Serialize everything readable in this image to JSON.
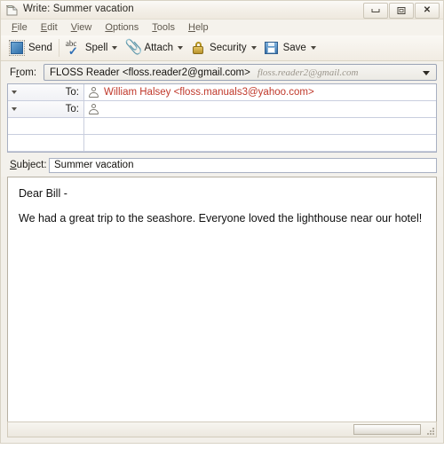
{
  "window": {
    "title": "Write: Summer vacation",
    "title_icon": "compose-document-icon",
    "controls": {
      "minimize": "minimize-button",
      "maximize": "maximize-button",
      "close": "close-button",
      "close_glyph": "✕"
    }
  },
  "menubar": {
    "items": [
      {
        "label": "File",
        "accel": "F"
      },
      {
        "label": "Edit",
        "accel": "E"
      },
      {
        "label": "View",
        "accel": "V"
      },
      {
        "label": "Options",
        "accel": "O"
      },
      {
        "label": "Tools",
        "accel": "T"
      },
      {
        "label": "Help",
        "accel": "H"
      }
    ]
  },
  "toolbar": {
    "send_label": "Send",
    "spell_label": "Spell",
    "spell_abc": "abc",
    "spell_check_glyph": "✓",
    "attach_label": "Attach",
    "attach_glyph": "📎",
    "security_label": "Security",
    "save_label": "Save"
  },
  "headers": {
    "from_label": "From:",
    "from_accel": "r",
    "from_value": "FLOSS Reader <floss.reader2@gmail.com>",
    "from_hint": "floss.reader2@gmail.com",
    "recipients": [
      {
        "type": "To:",
        "value": "William Halsey <floss.manuals3@yahoo.com>"
      },
      {
        "type": "To:",
        "value": ""
      }
    ],
    "subject_label": "Subject:",
    "subject_accel": "S",
    "subject_value": "Summer vacation"
  },
  "body": {
    "lines": [
      "Dear Bill -",
      "We had a great trip to the seashore. Everyone loved the lighthouse near our hotel!"
    ]
  },
  "statusbar": {
    "progress_value": ""
  },
  "colors": {
    "recipient_red": "#c0392b",
    "window_chrome": "#f2efe9",
    "field_border": "#a8b0c2",
    "send_icon_blue": "#2f6ea8",
    "lock_gold": "#b8922c"
  }
}
